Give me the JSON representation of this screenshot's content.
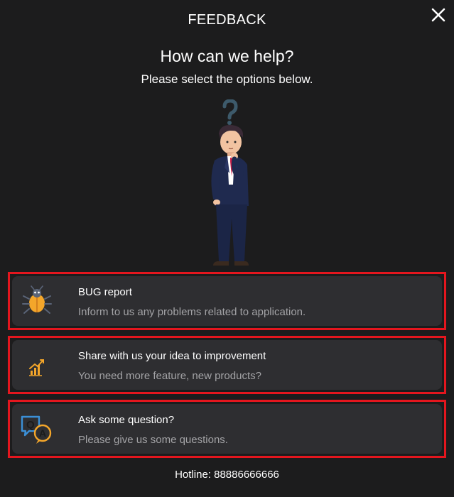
{
  "dialog": {
    "title": "FEEDBACK",
    "close_icon": "close-icon"
  },
  "intro": {
    "heading": "How can we help?",
    "subheading": "Please select the options below.",
    "illustration": "thinking-man-illustration"
  },
  "options": [
    {
      "icon": "bug-icon",
      "title": "BUG report",
      "description": "Inform to us any problems related to application."
    },
    {
      "icon": "growth-chart-icon",
      "title": "Share with us your idea to improvement",
      "description": "You need more feature, new products?"
    },
    {
      "icon": "qa-chat-icon",
      "title": "Ask some question?",
      "description": "Please give us some questions."
    }
  ],
  "footer": {
    "hotline": "Hotline: 88886666666"
  },
  "colors": {
    "background": "#1c1c1d",
    "card": "#2e2e31",
    "highlight_border": "#e4161e",
    "description_text": "#a3a3a6",
    "icon_accent": "#f4a62a"
  }
}
